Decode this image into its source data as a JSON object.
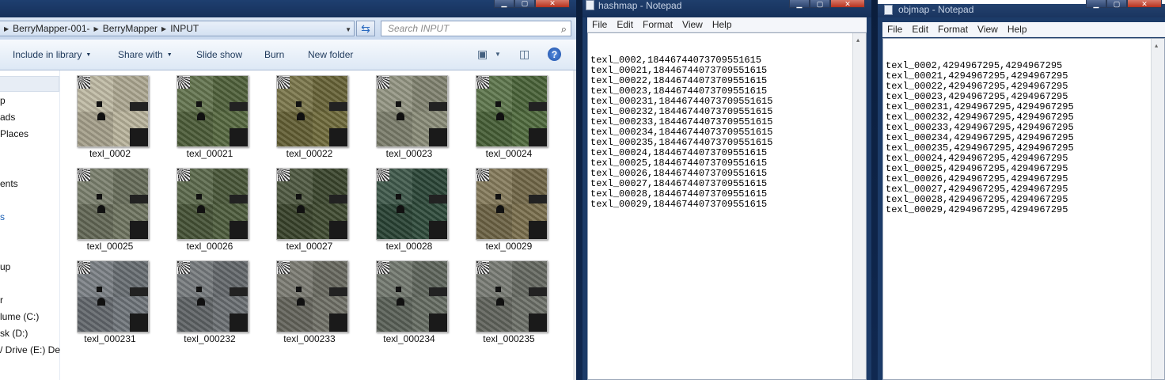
{
  "explorer": {
    "breadcrumb": [
      "BerryMapper-001-",
      "BerryMapper",
      "INPUT"
    ],
    "search_placeholder": "Search INPUT",
    "toolbar": {
      "include": "Include in library",
      "share": "Share with",
      "slideshow": "Slide show",
      "burn": "Burn",
      "newfolder": "New folder",
      "help": "?"
    },
    "nav": [
      "p",
      "ads",
      "Places",
      "ents",
      "s",
      "up",
      "r",
      "lume (C:)",
      "sk (D:)",
      "/ Drive (E:) Dea"
    ],
    "files": [
      {
        "name": "texl_0002",
        "tone": "#b9b49c"
      },
      {
        "name": "texl_00021",
        "tone": "#55683f"
      },
      {
        "name": "texl_00022",
        "tone": "#6e6a3a"
      },
      {
        "name": "texl_00023",
        "tone": "#8a8c78"
      },
      {
        "name": "texl_00024",
        "tone": "#4f6a3c"
      },
      {
        "name": "texl_00025",
        "tone": "#6e7460"
      },
      {
        "name": "texl_00026",
        "tone": "#4d5c3c"
      },
      {
        "name": "texl_00027",
        "tone": "#3f4a30"
      },
      {
        "name": "texl_00028",
        "tone": "#2e4a3a"
      },
      {
        "name": "texl_00029",
        "tone": "#7a6e4c"
      },
      {
        "name": "texl_000231",
        "tone": "#6e747a"
      },
      {
        "name": "texl_000232",
        "tone": "#6a6e72"
      },
      {
        "name": "texl_000233",
        "tone": "#6f7066"
      },
      {
        "name": "texl_000234",
        "tone": "#656c62"
      },
      {
        "name": "texl_000235",
        "tone": "#6c7068"
      }
    ]
  },
  "hashmap": {
    "title": "hashmap - Notepad",
    "menu": [
      "File",
      "Edit",
      "Format",
      "View",
      "Help"
    ],
    "content": "texl_0002,18446744073709551615\ntexl_00021,18446744073709551615\ntexl_00022,18446744073709551615\ntexl_00023,18446744073709551615\ntexl_000231,18446744073709551615\ntexl_000232,18446744073709551615\ntexl_000233,18446744073709551615\ntexl_000234,18446744073709551615\ntexl_000235,18446744073709551615\ntexl_00024,18446744073709551615\ntexl_00025,18446744073709551615\ntexl_00026,18446744073709551615\ntexl_00027,18446744073709551615\ntexl_00028,18446744073709551615\ntexl_00029,18446744073709551615"
  },
  "objmap": {
    "title": "objmap - Notepad",
    "menu": [
      "File",
      "Edit",
      "Format",
      "View",
      "Help"
    ],
    "content": "texl_0002,4294967295,4294967295\ntexl_00021,4294967295,4294967295\ntexl_00022,4294967295,4294967295\ntexl_00023,4294967295,4294967295\ntexl_000231,4294967295,4294967295\ntexl_000232,4294967295,4294967295\ntexl_000233,4294967295,4294967295\ntexl_000234,4294967295,4294967295\ntexl_000235,4294967295,4294967295\ntexl_00024,4294967295,4294967295\ntexl_00025,4294967295,4294967295\ntexl_00026,4294967295,4294967295\ntexl_00027,4294967295,4294967295\ntexl_00028,4294967295,4294967295\ntexl_00029,4294967295,4294967295"
  },
  "window_buttons": {
    "min": "▁",
    "max": "▢",
    "close": "✕"
  }
}
